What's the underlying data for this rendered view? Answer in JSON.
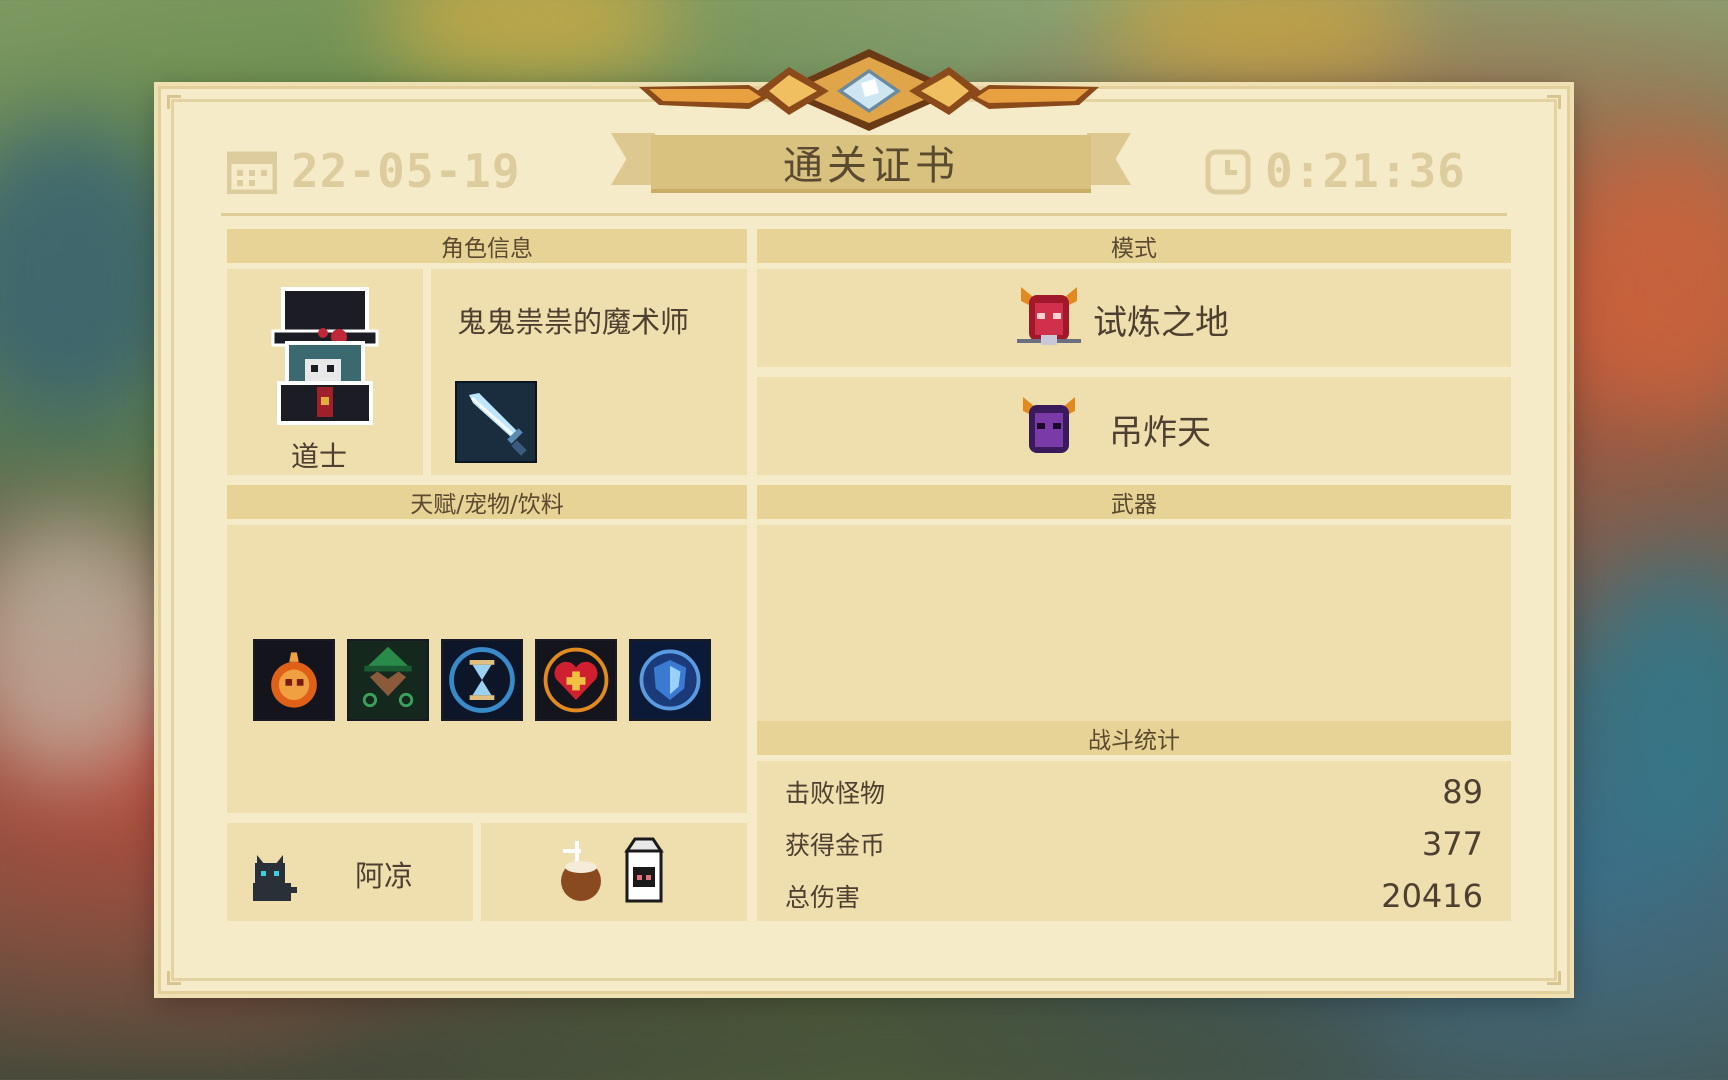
{
  "header": {
    "date": "22-05-19",
    "time": "0:21:36",
    "title": "通关证书",
    "calendar_icon": "calendar-icon",
    "clock_icon": "clock-icon"
  },
  "character": {
    "section_title": "角色信息",
    "class_name": "道士",
    "skin_name": "鬼鬼祟祟的魔术师",
    "weapon_icon": "blue-sword-icon"
  },
  "mode": {
    "section_title": "模式",
    "items": [
      {
        "label": "试炼之地",
        "icon": "red-demon-icon"
      },
      {
        "label": "吊炸天",
        "icon": "purple-demon-icon"
      }
    ]
  },
  "buffs": {
    "section_title": "天赋/宠物/饮料",
    "talents": [
      "flaming-skull-icon",
      "green-hat-heart-icon",
      "hourglass-icon",
      "red-heart-plus-icon",
      "blue-shield-icon"
    ],
    "pet": {
      "name": "阿凉",
      "icon": "black-cat-icon"
    },
    "drinks": [
      "coconut-drink-icon",
      "milk-carton-icon"
    ]
  },
  "weapons": {
    "section_title": "武器"
  },
  "battle_stats": {
    "section_title": "战斗统计",
    "rows": [
      {
        "label": "击败怪物",
        "value": "89"
      },
      {
        "label": "获得金币",
        "value": "377"
      },
      {
        "label": "总伤害",
        "value": "20416"
      }
    ]
  },
  "colors": {
    "paper": "#f6ebc9",
    "header_bar": "#e8d396",
    "text": "#4e4030",
    "faded_text": "#ddcc9d"
  }
}
